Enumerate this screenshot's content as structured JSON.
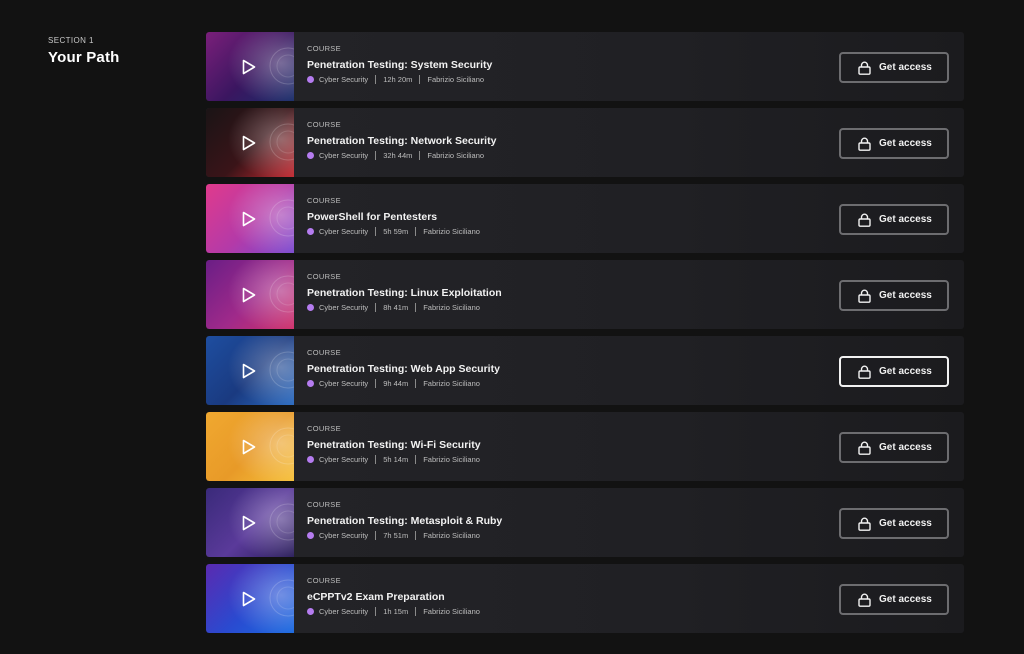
{
  "section": {
    "label": "SECTION 1",
    "title": "Your Path"
  },
  "courses": [
    {
      "kind": "COURSE",
      "title": "Penetration Testing: System Security",
      "category": "Cyber Security",
      "duration": "12h 20m",
      "author": "Fabrizio Siciliano",
      "button": "Get access",
      "theme": [
        "#7a1f7a",
        "#3a1660",
        "#1a2e6a"
      ]
    },
    {
      "kind": "COURSE",
      "title": "Penetration Testing: Network Security",
      "category": "Cyber Security",
      "duration": "32h 44m",
      "author": "Fabrizio Siciliano",
      "button": "Get access",
      "theme": [
        "#1a1416",
        "#3a1418",
        "#c42a32"
      ]
    },
    {
      "kind": "COURSE",
      "title": "PowerShell for Pentesters",
      "category": "Cyber Security",
      "duration": "5h 59m",
      "author": "Fabrizio Siciliano",
      "button": "Get access",
      "theme": [
        "#e03a8c",
        "#b43aa8",
        "#7a4ad0"
      ]
    },
    {
      "kind": "COURSE",
      "title": "Penetration Testing: Linux Exploitation",
      "category": "Cyber Security",
      "duration": "8h 41m",
      "author": "Fabrizio Siciliano",
      "button": "Get access",
      "theme": [
        "#6a1e86",
        "#a02a8a",
        "#d0306a"
      ]
    },
    {
      "kind": "COURSE",
      "title": "Penetration Testing: Web App Security",
      "category": "Cyber Security",
      "duration": "9h 44m",
      "author": "Fabrizio Siciliano",
      "button": "Get access",
      "theme": [
        "#1e4ea0",
        "#1a3a80",
        "#2a6ac0"
      ]
    },
    {
      "kind": "COURSE",
      "title": "Penetration Testing: Wi-Fi Security",
      "category": "Cyber Security",
      "duration": "5h 14m",
      "author": "Fabrizio Siciliano",
      "button": "Get access",
      "theme": [
        "#f0a830",
        "#e89a28",
        "#f6c03a"
      ]
    },
    {
      "kind": "COURSE",
      "title": "Penetration Testing: Metasploit & Ruby",
      "category": "Cyber Security",
      "duration": "7h 51m",
      "author": "Fabrizio Siciliano",
      "button": "Get access",
      "theme": [
        "#3a2a7a",
        "#5a3a9a",
        "#2a1e5a"
      ]
    },
    {
      "kind": "COURSE",
      "title": "eCPPTv2 Exam Preparation",
      "category": "Cyber Security",
      "duration": "1h 15m",
      "author": "Fabrizio Siciliano",
      "button": "Get access",
      "theme": [
        "#5a2ab0",
        "#2a4ad0",
        "#1a6ae0"
      ]
    }
  ],
  "colors": {
    "accent_dot": "#b57cf0",
    "background": "#121212"
  },
  "focused_index": 4
}
